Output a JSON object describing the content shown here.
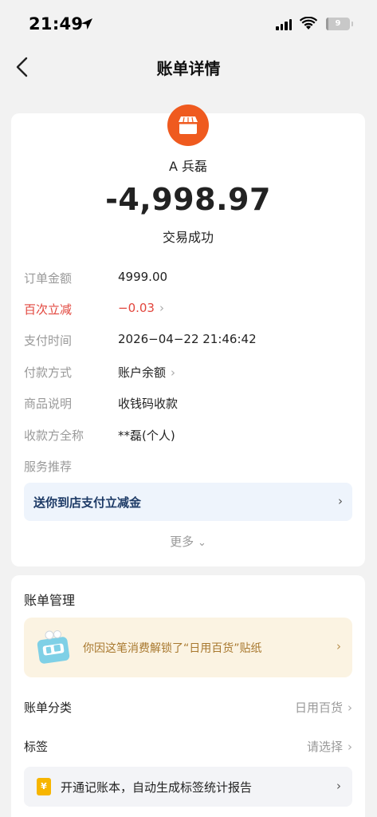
{
  "status_bar": {
    "time": "21:49",
    "battery": "9"
  },
  "nav": {
    "title": "账单详情",
    "back_icon": "chevron-left-icon"
  },
  "merchant": {
    "name": "A 兵磊",
    "logo_icon": "store-icon",
    "logo_color": "#ef5a1f"
  },
  "transaction": {
    "amount": "-4,998.97",
    "status": "交易成功"
  },
  "details": [
    {
      "label": "订单金额",
      "value": "4999.00"
    },
    {
      "label": "百次立减",
      "value": "−0.03"
    },
    {
      "label": "支付时间",
      "value": "2026−04−22 21:46:42"
    },
    {
      "label": "付款方式",
      "value": "账户余额"
    },
    {
      "label": "商品说明",
      "value": "收钱码收款"
    },
    {
      "label": "收款方全称",
      "value": "**磊(个人)"
    },
    {
      "label": "服务推荐",
      "value": ""
    }
  ],
  "promo": {
    "text": "送你到店支付立减金"
  },
  "more": {
    "label": "更多"
  },
  "manage": {
    "title": "账单管理",
    "sticker_text": "你因这笔消费解锁了“日用百货”贴纸",
    "category_label": "账单分类",
    "category_value": "日用百货",
    "tag_label": "标签",
    "tag_value": "请选择",
    "ledger_icon_text": "¥",
    "ledger_text": "开通记账本，自动生成标签统计报告"
  },
  "colors": {
    "accent_orange": "#ef5a1f",
    "discount_red": "#e2453c",
    "promo_bg": "#eef4fc",
    "sticker_bg": "#fbf3e2"
  }
}
